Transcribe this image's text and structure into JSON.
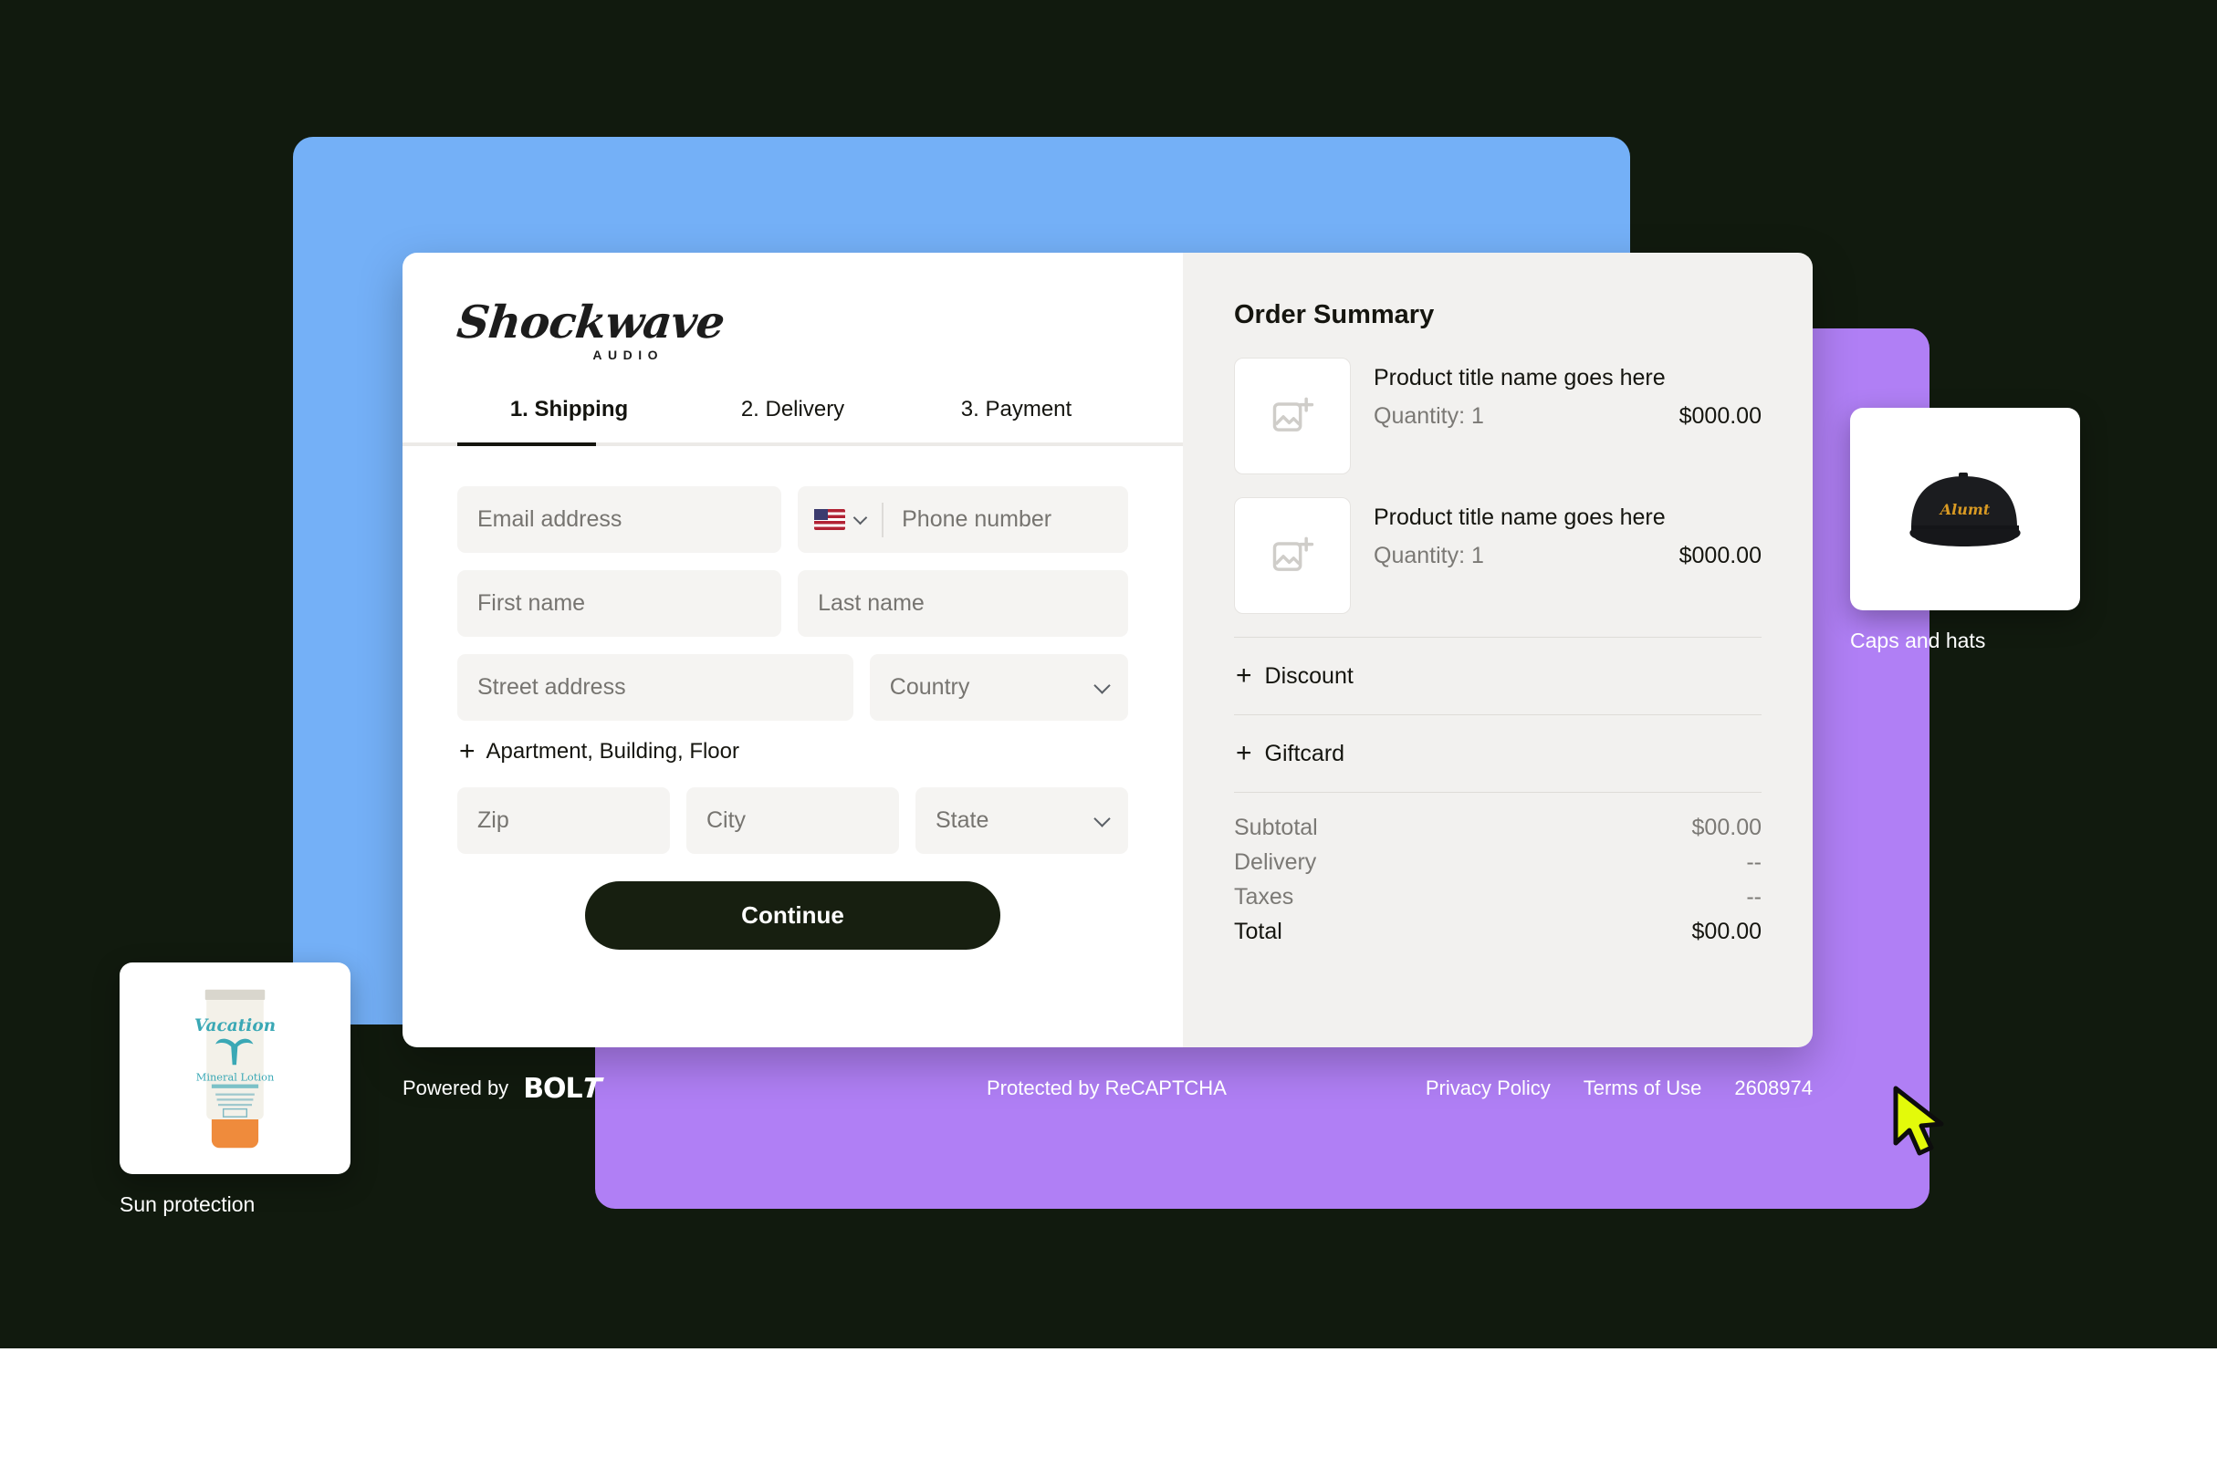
{
  "brand": {
    "logo_script": "Shockwave",
    "logo_sub": "AUDIO"
  },
  "tabs": [
    {
      "label": "1. Shipping",
      "active": true
    },
    {
      "label": "2. Delivery",
      "active": false
    },
    {
      "label": "3. Payment",
      "active": false
    }
  ],
  "form": {
    "email_placeholder": "Email address",
    "phone_placeholder": "Phone number",
    "phone_country_flag": "us-flag-icon",
    "first_name_placeholder": "First name",
    "last_name_placeholder": "Last name",
    "street_placeholder": "Street address",
    "country_placeholder": "Country",
    "apartment_link": "Apartment, Building, Floor",
    "zip_placeholder": "Zip",
    "city_placeholder": "City",
    "state_placeholder": "State",
    "continue_label": "Continue",
    "plus": "+"
  },
  "summary": {
    "title": "Order Summary",
    "items": [
      {
        "title": "Product title name goes here",
        "quantity": "Quantity: 1",
        "price": "$000.00"
      },
      {
        "title": "Product title name goes here",
        "quantity": "Quantity: 1",
        "price": "$000.00"
      }
    ],
    "addons": [
      {
        "label": "Discount"
      },
      {
        "label": "Giftcard"
      }
    ],
    "totals": [
      {
        "label": "Subtotal",
        "value": "$00.00"
      },
      {
        "label": "Delivery",
        "value": "--"
      },
      {
        "label": "Taxes",
        "value": "--"
      },
      {
        "label": "Total",
        "value": "$00.00"
      }
    ]
  },
  "footer": {
    "powered_by": "Powered by",
    "bolt_brand": "BOL",
    "bolt_t": "T",
    "recaptcha": "Protected by ReCAPTCHA",
    "privacy_policy": "Privacy Policy",
    "terms_of_use": "Terms of Use",
    "order_number": "2608974"
  },
  "product_cards": [
    {
      "label": "Sun protection",
      "image": "sunscreen-tube-image"
    },
    {
      "label": "Caps and hats",
      "image": "black-cap-image"
    }
  ],
  "colors": {
    "backdrop": "#111a0e",
    "panel_blue": "#74b0f7",
    "panel_purple": "#b07ff5",
    "card_white": "#ffffff",
    "summary_bg": "#f2f1ef",
    "button_dark": "#171f10",
    "cursor_yellow": "#e3fa0a"
  }
}
